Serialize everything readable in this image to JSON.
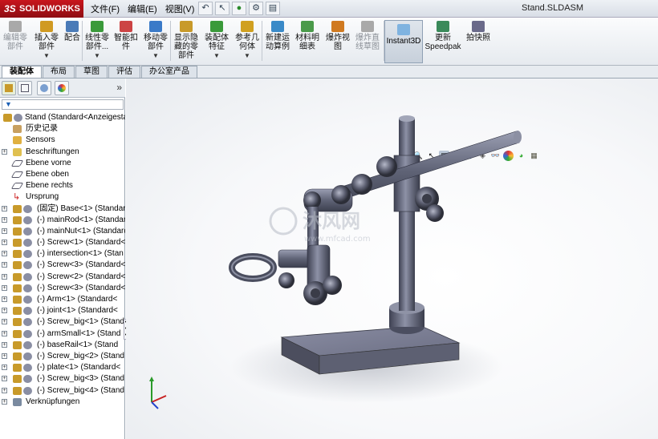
{
  "app": {
    "brand_prefix": "3S",
    "brand": "SOLIDWORKS"
  },
  "menu": [
    "文件(F)",
    "编辑(E)",
    "视图(V)"
  ],
  "document_title": "Stand.SLDASM",
  "ribbon": {
    "buttons": [
      {
        "label": "编辑零\n部件",
        "disabled": true
      },
      {
        "label": "插入零\n部件",
        "dropdown": true
      },
      {
        "label": "配合"
      },
      {
        "label": "线性零\n部件...",
        "dropdown": true
      },
      {
        "label": "智能扣\n件"
      },
      {
        "label": "移动零\n部件",
        "dropdown": true
      },
      {
        "label": "显示隐\n藏的零\n部件"
      },
      {
        "label": "装配体\n特征",
        "dropdown": true
      },
      {
        "label": "参考几\n何体",
        "dropdown": true
      },
      {
        "label": "新建运\n动算例"
      },
      {
        "label": "材料明\n细表"
      },
      {
        "label": "爆炸视\n图"
      },
      {
        "label": "爆炸直\n线草图",
        "disabled": true
      },
      {
        "label": "更新\nSpeedpak"
      },
      {
        "label": "拍快照"
      }
    ],
    "instant3d": "Instant3D"
  },
  "command_tabs": [
    "装配体",
    "布局",
    "草图",
    "评估",
    "办公室产品"
  ],
  "tree": {
    "filter": "▼",
    "root": "Stand  (Standard<Anzeigestatus",
    "items": [
      {
        "label": "历史记录",
        "type": "history"
      },
      {
        "label": "Sensors",
        "type": "sensor"
      },
      {
        "label": "Beschriftungen",
        "type": "annotation",
        "expand": true
      },
      {
        "label": "Ebene vorne",
        "type": "plane"
      },
      {
        "label": "Ebene oben",
        "type": "plane"
      },
      {
        "label": "Ebene rechts",
        "type": "plane"
      },
      {
        "label": "Ursprung",
        "type": "origin"
      },
      {
        "label": "(固定) Base<1> (Standard",
        "type": "part",
        "expand": true
      },
      {
        "label": "(-) mainRod<1> (Standard",
        "type": "part",
        "expand": true
      },
      {
        "label": "(-) mainNut<1> (Standard",
        "type": "part",
        "expand": true
      },
      {
        "label": "(-) Screw<1> (Standard<",
        "type": "part",
        "expand": true
      },
      {
        "label": "(-) intersection<1> (Stan",
        "type": "part",
        "expand": true
      },
      {
        "label": "(-) Screw<3> (Standard<",
        "type": "part",
        "expand": true
      },
      {
        "label": "(-) Screw<2> (Standard<",
        "type": "part",
        "expand": true
      },
      {
        "label": "(-) Screw<3> (Standard<",
        "type": "part",
        "expand": true
      },
      {
        "label": "(-) Arm<1> (Standard<",
        "type": "part",
        "expand": true
      },
      {
        "label": "(-) joint<1> (Standard<",
        "type": "part",
        "expand": true
      },
      {
        "label": "(-) Screw_big<1> (Stand",
        "type": "part",
        "expand": true
      },
      {
        "label": "(-) armSmall<1> (Stand",
        "type": "part",
        "expand": true
      },
      {
        "label": "(-) baseRail<1> (Stand",
        "type": "part",
        "expand": true
      },
      {
        "label": "(-) Screw_big<2> (Stand",
        "type": "part",
        "expand": true
      },
      {
        "label": "(-) plate<1> (Standard<",
        "type": "part",
        "expand": true
      },
      {
        "label": "(-) Screw_big<3> (Stand",
        "type": "part",
        "expand": true
      },
      {
        "label": "(-) Screw_big<4> (Stand",
        "type": "part",
        "expand": true
      },
      {
        "label": "Verknüpfungen",
        "type": "mates",
        "expand": true
      }
    ]
  },
  "watermark": {
    "main": "沐风网",
    "sub": "www.mfcad.com"
  },
  "colors": {
    "part": "#5a5d70",
    "part_light": "#8a8ea3",
    "accent_red": "#c8161d"
  }
}
